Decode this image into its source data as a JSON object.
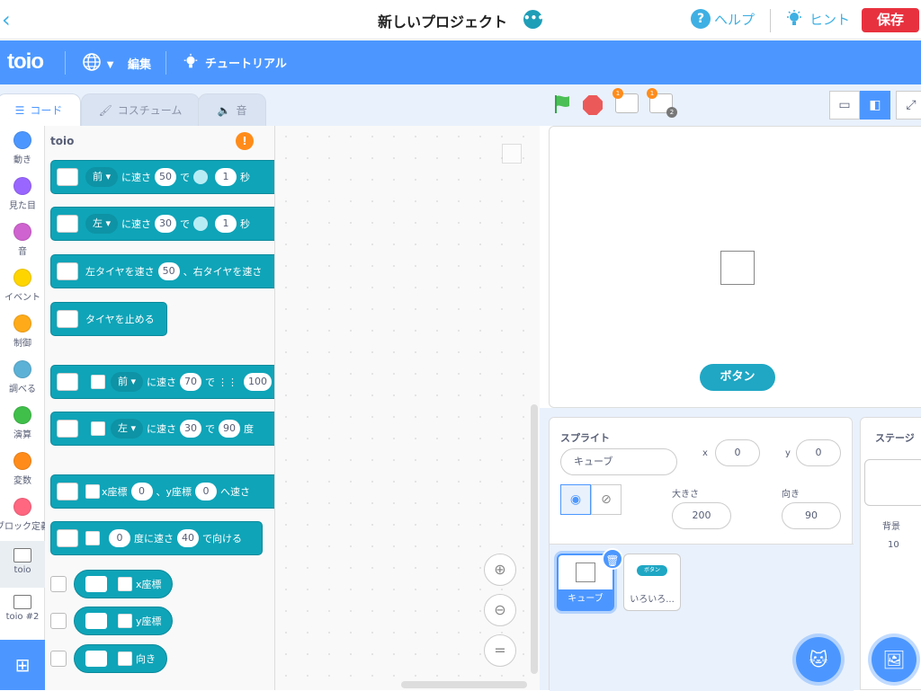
{
  "header": {
    "back_icon": "‹",
    "title": "新しいプロジェクト",
    "more_icon": "•••",
    "help_label": "ヘルプ",
    "help_icon": "?",
    "hint_label": "ヒント",
    "save_label": "保存"
  },
  "menubar": {
    "logo": "toio",
    "edit_label": "編集",
    "tutorial_label": "チュートリアル"
  },
  "tabs": {
    "code": "コード",
    "costume": "コスチューム",
    "sound": "音"
  },
  "categories": [
    {
      "label": "動き",
      "color": "#4c97ff"
    },
    {
      "label": "見た目",
      "color": "#9966ff"
    },
    {
      "label": "音",
      "color": "#cf63cf"
    },
    {
      "label": "イベント",
      "color": "#ffd500"
    },
    {
      "label": "制御",
      "color": "#ffab19"
    },
    {
      "label": "調べる",
      "color": "#5cb1d6"
    },
    {
      "label": "演算",
      "color": "#40bf4a"
    },
    {
      "label": "変数",
      "color": "#ff8c1a"
    },
    {
      "label": "ブロック定義",
      "color": "#ff6680"
    },
    {
      "label": "toio",
      "color": ""
    },
    {
      "label": "toio #2",
      "color": ""
    }
  ],
  "palette": {
    "title": "toio",
    "warn_icon": "!",
    "b1": {
      "dir": "前",
      "t1": "に速さ",
      "speed": "50",
      "t2": "で",
      "time": "1",
      "t3": "秒"
    },
    "b2": {
      "dir": "左",
      "t1": "に速さ",
      "speed": "30",
      "t2": "で",
      "time": "1",
      "t3": "秒"
    },
    "b3": {
      "t1": "左タイヤを速さ",
      "speed": "50",
      "t2": "、右タイヤを速さ"
    },
    "b4": {
      "t1": "タイヤを止める"
    },
    "b5": {
      "dir": "前",
      "t1": "に速さ",
      "speed": "70",
      "t2": "で",
      "dist": "100"
    },
    "b6": {
      "dir": "左",
      "t1": "に速さ",
      "speed": "30",
      "t2": "で",
      "angle": "90",
      "t3": "度"
    },
    "b7": {
      "t1": "x座標",
      "x": "0",
      "t2": "、y座標",
      "y": "0",
      "t3": "へ速さ"
    },
    "b8": {
      "angle": "0",
      "t1": "度に速さ",
      "speed": "40",
      "t2": "で向ける"
    },
    "r1": "x座標",
    "r2": "y座標",
    "r3": "向き"
  },
  "stage": {
    "button_label": "ボタン"
  },
  "sprite": {
    "title": "スプライト",
    "name": "キューブ",
    "x_label": "x",
    "x": "0",
    "y_label": "y",
    "y": "0",
    "size_label": "大きさ",
    "size": "200",
    "direction_label": "向き",
    "direction": "90",
    "thumbs": [
      {
        "name": "キューブ"
      },
      {
        "name": "いろいろ...",
        "badge": "ボタン"
      }
    ]
  },
  "stagepane": {
    "title": "ステージ",
    "backdrop_label": "背景",
    "backdrop_count": "10"
  },
  "badges": {
    "cube1": "1",
    "cube2_top": "1",
    "cube2_bottom": "2"
  }
}
